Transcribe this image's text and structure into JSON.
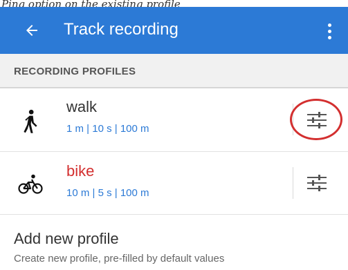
{
  "caption": "Ping option on the existing profile",
  "appbar": {
    "title": "Track recording",
    "back_icon": "arrow-left-icon",
    "menu_icon": "more-vertical-icon",
    "color": "#2c7ad6"
  },
  "section": {
    "header": "RECORDING PROFILES"
  },
  "profiles": [
    {
      "name": "walk",
      "params": "1 m | 10 s | 100 m",
      "icon": "walking-person-icon",
      "name_color": "#333333"
    },
    {
      "name": "bike",
      "params": "10 m | 5 s | 100 m",
      "icon": "bicycle-icon",
      "name_color": "#d32f2f"
    }
  ],
  "add_profile": {
    "title": "Add new profile",
    "subtitle": "Create new profile, pre-filled by default values"
  }
}
